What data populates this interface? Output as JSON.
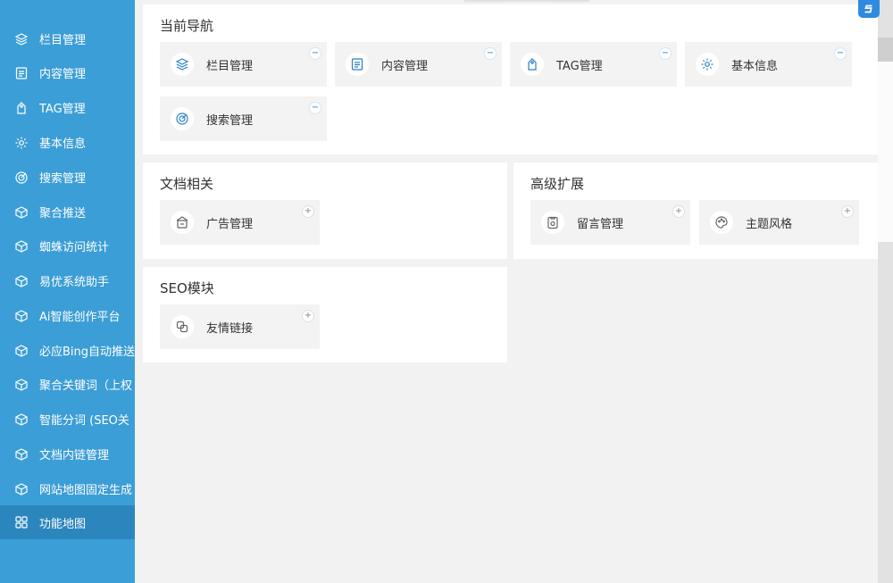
{
  "colors": {
    "sidebar_bg": "#3c9ed6",
    "sidebar_active": "#2b86bd",
    "accent": "#2a80c2"
  },
  "sidebar": {
    "items": [
      {
        "label": "栏目管理",
        "icon": "layers-icon"
      },
      {
        "label": "内容管理",
        "icon": "document-icon"
      },
      {
        "label": "TAG管理",
        "icon": "tag-icon"
      },
      {
        "label": "基本信息",
        "icon": "gear-icon"
      },
      {
        "label": "搜索管理",
        "icon": "target-icon"
      },
      {
        "label": "聚合推送",
        "icon": "cube-icon"
      },
      {
        "label": "蜘蛛访问统计",
        "icon": "cube-icon"
      },
      {
        "label": "易优系统助手",
        "icon": "cube-icon"
      },
      {
        "label": "Ai智能创作平台",
        "icon": "cube-icon"
      },
      {
        "label": "必应Bing自动推送",
        "icon": "cube-icon"
      },
      {
        "label": "聚合关键词（上权",
        "icon": "cube-icon"
      },
      {
        "label": "智能分词 (SEO关",
        "icon": "cube-icon"
      },
      {
        "label": "文档内链管理",
        "icon": "cube-icon"
      },
      {
        "label": "网站地图固定生成",
        "icon": "cube-icon"
      },
      {
        "label": "功能地图",
        "icon": "grid-icon",
        "active": true
      }
    ]
  },
  "sections": {
    "current_nav": {
      "title": "当前导航",
      "items": [
        {
          "label": "栏目管理",
          "icon": "layers-icon",
          "toggle": "−"
        },
        {
          "label": "内容管理",
          "icon": "document-icon",
          "toggle": "−"
        },
        {
          "label": "TAG管理",
          "icon": "tag-icon",
          "toggle": "−"
        },
        {
          "label": "基本信息",
          "icon": "gear-icon",
          "toggle": "−"
        },
        {
          "label": "搜索管理",
          "icon": "target-icon",
          "toggle": "−"
        }
      ]
    },
    "doc_related": {
      "title": "文档相关",
      "items": [
        {
          "label": "广告管理",
          "icon": "ad-icon",
          "toggle": "+"
        }
      ]
    },
    "advanced": {
      "title": "高级扩展",
      "items": [
        {
          "label": "留言管理",
          "icon": "message-icon",
          "toggle": "+"
        },
        {
          "label": "主题风格",
          "icon": "palette-icon",
          "toggle": "+"
        }
      ]
    },
    "seo": {
      "title": "SEO模块",
      "items": [
        {
          "label": "友情链接",
          "icon": "link-icon",
          "toggle": "+"
        }
      ]
    }
  }
}
